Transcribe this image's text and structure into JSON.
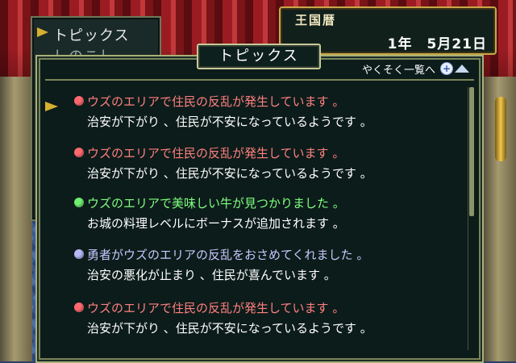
{
  "back_menu": {
    "items": [
      {
        "label": "トピックス"
      },
      {
        "label": "しのこし"
      }
    ]
  },
  "calendar": {
    "title": "王国暦",
    "year": "1年",
    "date": "5月21日"
  },
  "panel": {
    "title": "トピックス",
    "promise_link": "やくそく一覧へ",
    "topics": [
      {
        "headline": "ウズのエリアで住民の反乱が発生しています 。",
        "detail": "治安が下がり 、住民が不安になっているようです 。",
        "color": "#ff8080",
        "bullet": "#ff6a70"
      },
      {
        "headline": "ウズのエリアで住民の反乱が発生しています 。",
        "detail": "治安が下がり 、住民が不安になっているようです 。",
        "color": "#ff8080",
        "bullet": "#ff6a70"
      },
      {
        "headline": "ウズのエリアで美味しい牛が見つかりました 。",
        "detail": "お城の料理レベルにボーナスが追加されます 。",
        "color": "#80ff80",
        "bullet": "#70f070"
      },
      {
        "headline": "勇者がウズのエリアの反乱をおさめてくれました 。",
        "detail": "治安の悪化が止まり 、住民が喜んでいます 。",
        "color": "#c8c8ff",
        "bullet": "#b8b8f8"
      },
      {
        "headline": "ウズのエリアで住民の反乱が発生しています 。",
        "detail": "治安が下がり 、住民が不安になっているようです 。",
        "color": "#ff8080",
        "bullet": "#ff6a70"
      }
    ]
  }
}
